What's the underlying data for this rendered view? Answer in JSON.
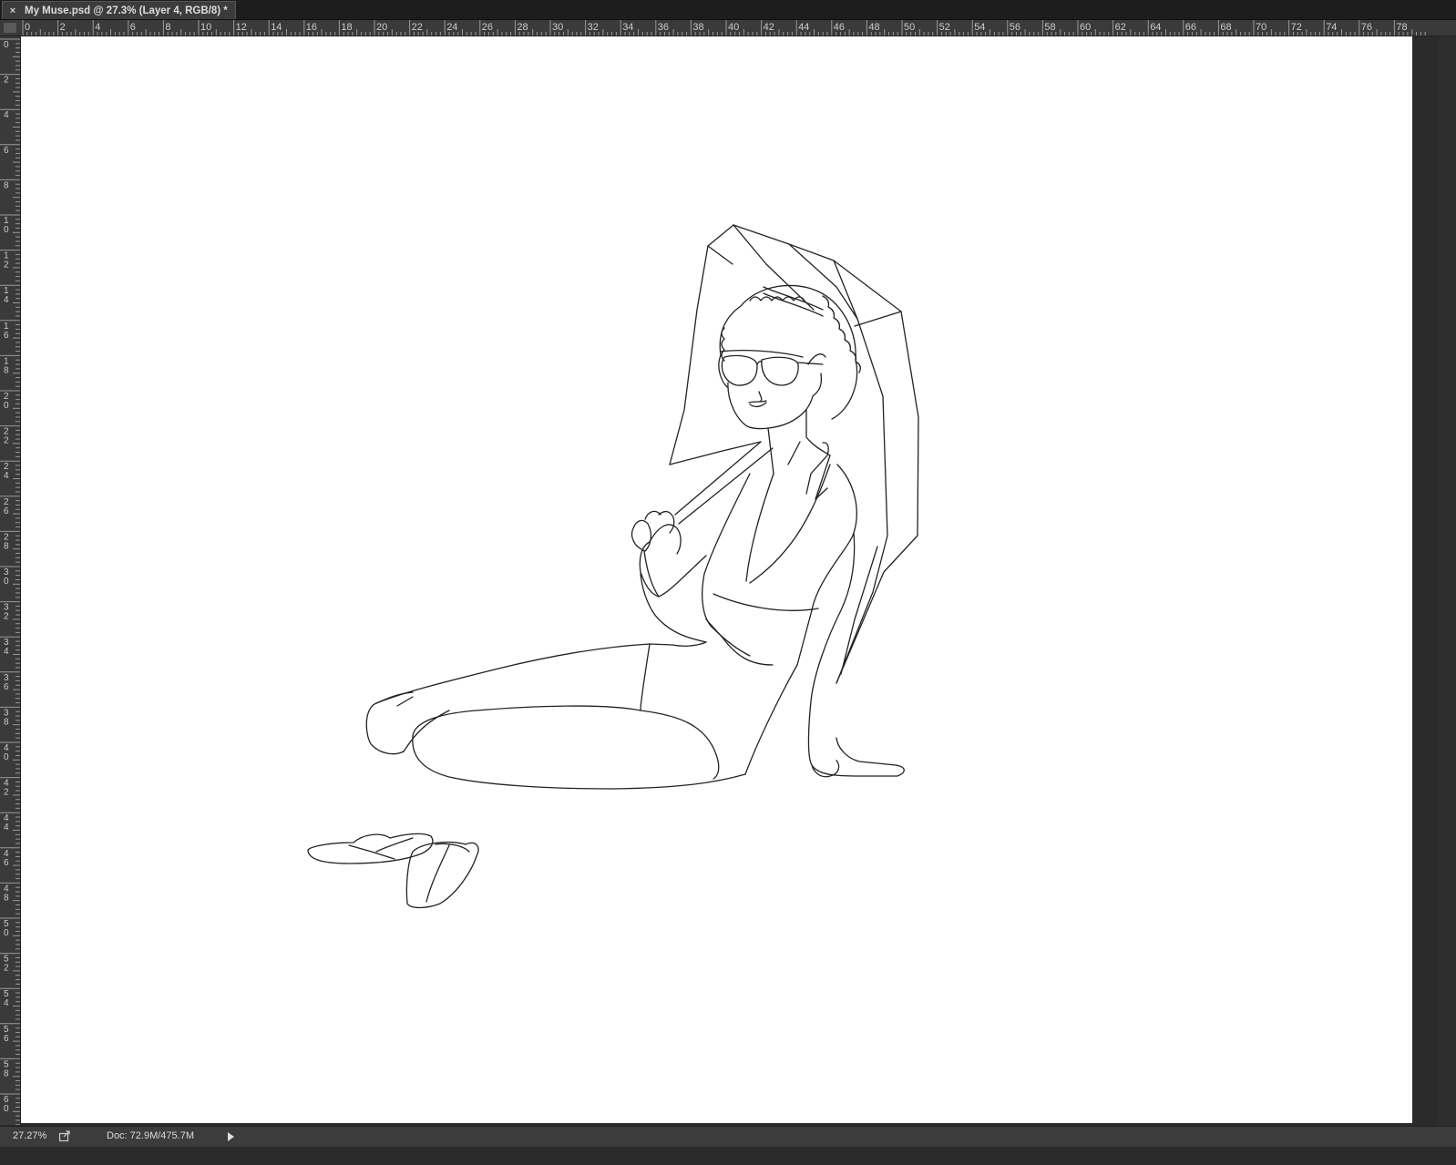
{
  "document_tab": {
    "close_glyph": "×",
    "title": "My Muse.psd @ 27.3% (Layer 4, RGB/8) *"
  },
  "rulers": {
    "horizontal_labels": [
      "0",
      "2",
      "4",
      "6",
      "8",
      "10",
      "12",
      "14",
      "16",
      "18",
      "20",
      "22",
      "24",
      "26",
      "28",
      "30",
      "32",
      "34",
      "36",
      "38",
      "40",
      "42",
      "44",
      "46",
      "48",
      "50",
      "52",
      "54",
      "56",
      "58",
      "60",
      "62",
      "64",
      "66",
      "68",
      "70",
      "72",
      "74",
      "76",
      "78"
    ],
    "vertical_labels": [
      "0",
      "2",
      "4",
      "6",
      "8",
      "10",
      "12",
      "14",
      "16",
      "18",
      "20",
      "22",
      "24",
      "26",
      "28",
      "30",
      "32",
      "34",
      "36",
      "38",
      "40",
      "42",
      "44",
      "46",
      "48",
      "50",
      "52",
      "54",
      "56",
      "58",
      "60"
    ]
  },
  "canvas": {
    "artwork": "line-art-woman-with-umbrella",
    "background": "#ffffff"
  },
  "status_bar": {
    "zoom": "27.27%",
    "doc_size": "Doc: 72.9M/475.7M"
  },
  "colors": {
    "app_bg": "#2b2b2b",
    "panel_bg": "#3c3c3c",
    "line_art": "#222222"
  }
}
